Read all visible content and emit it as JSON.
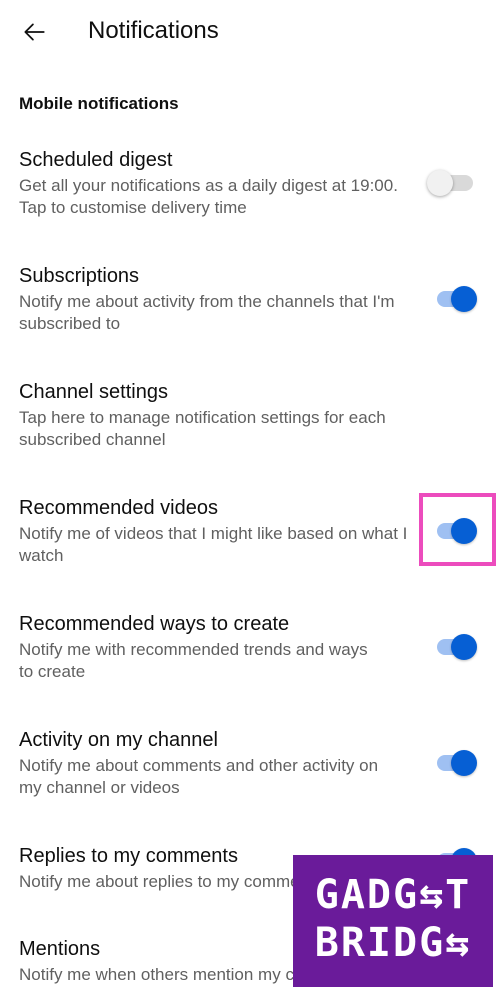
{
  "header": {
    "back_icon": "arrow-left-icon",
    "title": "Notifications"
  },
  "section": {
    "title": "Mobile notifications"
  },
  "settings": [
    {
      "title": "Scheduled digest",
      "description": "Get all your notifications as a daily digest at 19:00. Tap to customise delivery time",
      "toggle": "off"
    },
    {
      "title": "Subscriptions",
      "description": "Notify me about activity from the channels that I'm subscribed to",
      "toggle": "on"
    },
    {
      "title": "Channel settings",
      "description": "Tap here to manage notification settings for each subscribed channel",
      "toggle": "none"
    },
    {
      "title": "Recommended videos",
      "description": "Notify me of videos that I might like based on what I watch",
      "toggle": "on"
    },
    {
      "title": "Recommended ways to create",
      "description": "Notify me with recommended trends and ways to create",
      "toggle": "on"
    },
    {
      "title": "Activity on my channel",
      "description": "Notify me about comments and other activity on my channel or videos",
      "toggle": "on"
    },
    {
      "title": "Replies to my comments",
      "description": "Notify me about replies to my comments",
      "toggle": "on"
    },
    {
      "title": "Mentions",
      "description": "Notify me when others mention my channel",
      "toggle": "on"
    }
  ],
  "watermark": {
    "line1": "GADG⇆T",
    "line2": "BRIDG⇆"
  },
  "colors": {
    "accent": "#065fd4",
    "track_on": "#9fc0f2",
    "highlight": "#ec4cbd",
    "watermark_bg": "#6a1b9a"
  }
}
